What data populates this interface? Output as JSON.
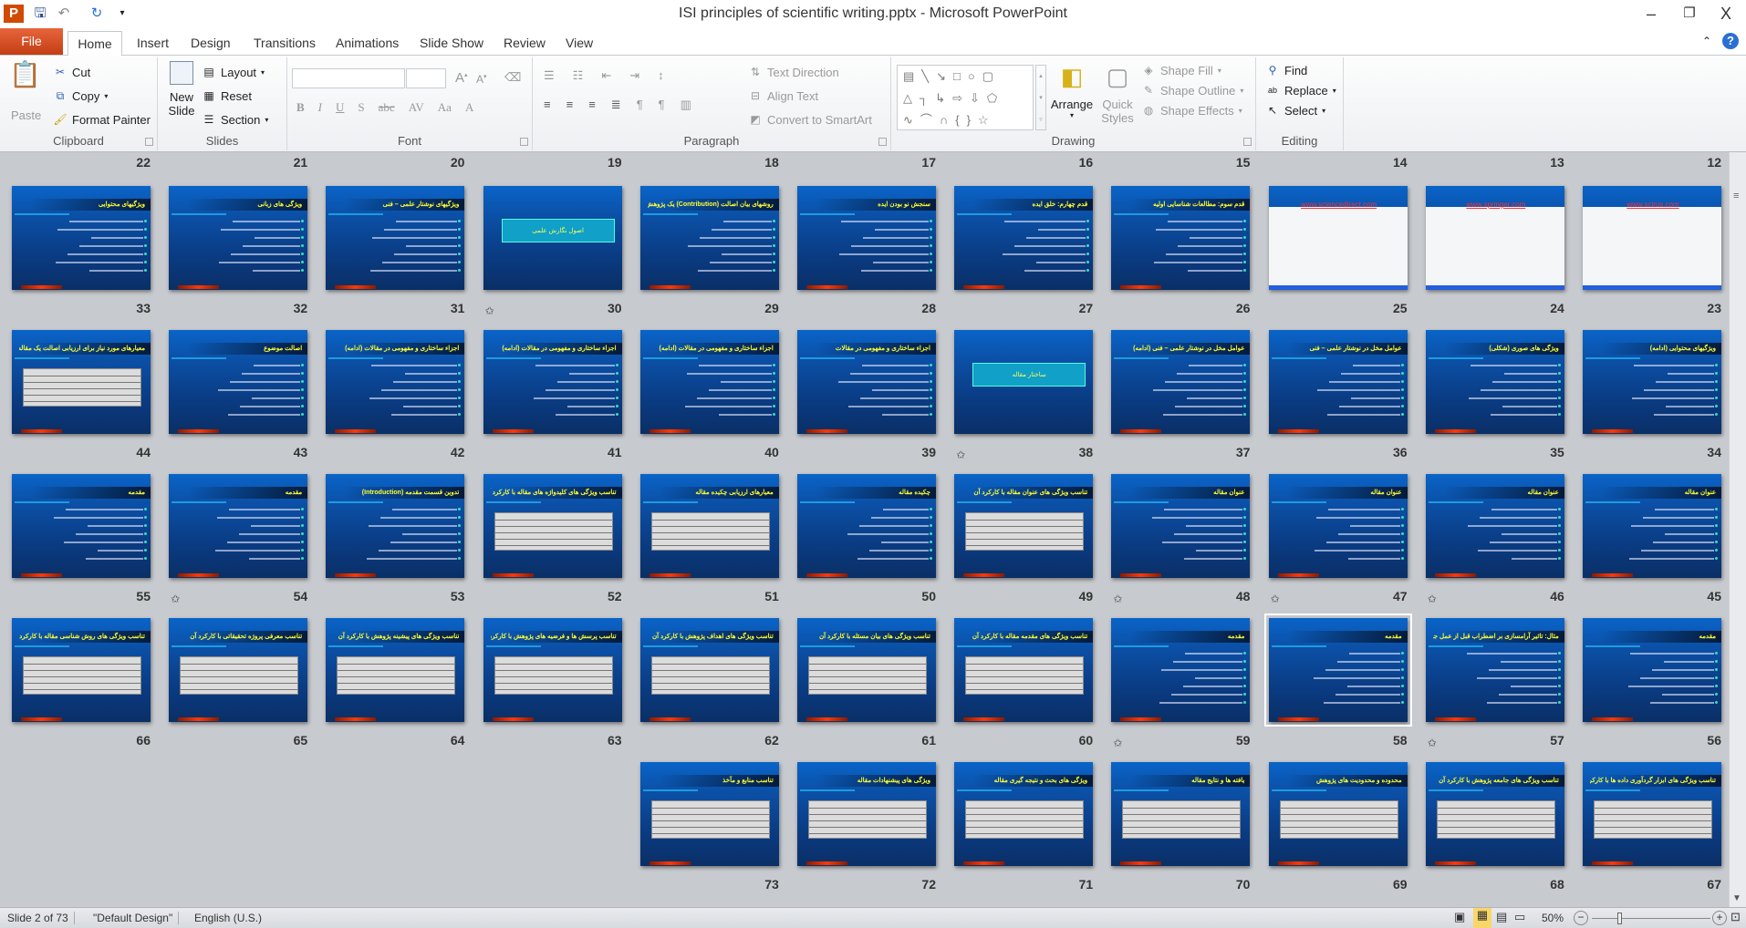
{
  "window": {
    "title": "ISI principles of scientific writing.pptx - Microsoft PowerPoint",
    "minimize": "–",
    "restore": "❐",
    "close": "X"
  },
  "quick_access": [
    "save-icon",
    "undo-icon",
    "redo-icon",
    "customize-icon"
  ],
  "tabs": {
    "file": "File",
    "items": [
      "Home",
      "Insert",
      "Design",
      "Transitions",
      "Animations",
      "Slide Show",
      "Review",
      "View"
    ],
    "active": "Home"
  },
  "ribbon": {
    "clipboard": {
      "label": "Clipboard",
      "paste": "Paste",
      "cut": "Cut",
      "copy": "Copy",
      "format_painter": "Format Painter"
    },
    "slides": {
      "label": "Slides",
      "new_slide_1": "New",
      "new_slide_2": "Slide",
      "layout": "Layout",
      "reset": "Reset",
      "section": "Section"
    },
    "font": {
      "label": "Font",
      "font_name": "",
      "font_size": ""
    },
    "paragraph": {
      "label": "Paragraph",
      "text_direction": "Text Direction",
      "align_text": "Align Text",
      "convert_smartart": "Convert to SmartArt"
    },
    "drawing": {
      "label": "Drawing",
      "arrange": "Arrange",
      "quick_styles_1": "Quick",
      "quick_styles_2": "Styles",
      "shape_fill": "Shape Fill",
      "shape_outline": "Shape Outline",
      "shape_effects": "Shape Effects"
    },
    "editing": {
      "label": "Editing",
      "find": "Find",
      "replace": "Replace",
      "select": "Select"
    }
  },
  "sorter": {
    "partial_row_numbers": [
      22,
      21,
      20,
      19,
      18,
      17,
      16,
      15,
      14,
      13,
      12
    ],
    "slides": [
      {
        "n": 23,
        "title": "www.scirus.com",
        "kind": "web"
      },
      {
        "n": 24,
        "title": "www.springer.com",
        "kind": "web"
      },
      {
        "n": 25,
        "title": "www.sciencedirect.com",
        "kind": "web"
      },
      {
        "n": 26,
        "title": "قدم سوم: مطالعات شناسایی اولیه",
        "kind": "bullets"
      },
      {
        "n": 27,
        "title": "قدم چهارم: خلق ایده",
        "kind": "bullets"
      },
      {
        "n": 28,
        "title": "سنجش نو بودن ایده",
        "kind": "bullets"
      },
      {
        "n": 29,
        "title": "روشهای بیان اصالت (Contribution) یک پژوهش",
        "kind": "bullets"
      },
      {
        "n": 30,
        "title": "اصول نگارش علمی",
        "kind": "section",
        "star": true
      },
      {
        "n": 31,
        "title": "ویژگیهای نوشتار علمی – فنی",
        "kind": "bullets"
      },
      {
        "n": 32,
        "title": "ویژگی های زبانی",
        "kind": "bullets"
      },
      {
        "n": 33,
        "title": "ویژگیهای محتوایی",
        "kind": "bullets"
      },
      {
        "n": 34,
        "title": "ویژگیهای محتوایی (ادامه)",
        "kind": "bullets"
      },
      {
        "n": 35,
        "title": "ویژگی های صوری (شکلی)",
        "kind": "bullets"
      },
      {
        "n": 36,
        "title": "عوامل مخل در نوشتار علمی – فنی",
        "kind": "bullets"
      },
      {
        "n": 37,
        "title": "عوامل مخل در نوشتار علمی – فنی (ادامه)",
        "kind": "bullets"
      },
      {
        "n": 38,
        "title": "ساختار مقاله",
        "kind": "section",
        "star": true
      },
      {
        "n": 39,
        "title": "اجزاء ساختاری و مفهومی در مقالات",
        "kind": "bullets"
      },
      {
        "n": 40,
        "title": "اجزاء ساختاری و مفهومی در مقالات (ادامه)",
        "kind": "bullets"
      },
      {
        "n": 41,
        "title": "اجزاء ساختاری و مفهومی در مقالات (ادامه)",
        "kind": "bullets"
      },
      {
        "n": 42,
        "title": "اجزاء ساختاری و مفهومی در مقالات (ادامه)",
        "kind": "bullets"
      },
      {
        "n": 43,
        "title": "اصالت موضوع",
        "kind": "bullets"
      },
      {
        "n": 44,
        "title": "معیارهای مورد نیاز برای ارزیابی اصالت یک مقاله",
        "kind": "table"
      },
      {
        "n": 45,
        "title": "عنوان مقاله",
        "kind": "bullets"
      },
      {
        "n": 46,
        "title": "عنوان مقاله",
        "kind": "bullets",
        "star": true
      },
      {
        "n": 47,
        "title": "عنوان مقاله",
        "kind": "bullets",
        "star": true
      },
      {
        "n": 48,
        "title": "عنوان مقاله",
        "kind": "bullets",
        "star": true
      },
      {
        "n": 49,
        "title": "تناسب ویژگی های عنوان مقاله با کارکرد آن",
        "kind": "table"
      },
      {
        "n": 50,
        "title": "چکیده مقاله",
        "kind": "bullets"
      },
      {
        "n": 51,
        "title": "معیارهای ارزیابی چکیده مقاله",
        "kind": "table"
      },
      {
        "n": 52,
        "title": "تناسب ویژگی های کلیدواژه های مقاله با کارکرد آن",
        "kind": "table"
      },
      {
        "n": 53,
        "title": "تدوین قسمت مقدمه (Introduction)",
        "kind": "bullets"
      },
      {
        "n": 54,
        "title": "مقدمه",
        "kind": "bullets",
        "star": true
      },
      {
        "n": 55,
        "title": "مقدمه",
        "kind": "bullets"
      },
      {
        "n": 56,
        "title": "مقدمه",
        "kind": "bullets"
      },
      {
        "n": 57,
        "title": "مثال: تاثیر آرامسازی بر اضطراب قبل از عمل جراحی",
        "kind": "bullets",
        "star": true
      },
      {
        "n": 58,
        "title": "مقدمه",
        "kind": "bullets",
        "selected": true
      },
      {
        "n": 59,
        "title": "مقدمه",
        "kind": "bullets",
        "star": true
      },
      {
        "n": 60,
        "title": "تناسب ویژگی های مقدمه مقاله با کارکرد آن",
        "kind": "table"
      },
      {
        "n": 61,
        "title": "تناسب ویژگی های بیان مسئله با کارکرد آن",
        "kind": "table"
      },
      {
        "n": 62,
        "title": "تناسب ویژگی های اهداف پژوهش با کارکرد آن",
        "kind": "table"
      },
      {
        "n": 63,
        "title": "تناسب پرسش ها و فرضیه های پژوهش با کارکرد آن",
        "kind": "table"
      },
      {
        "n": 64,
        "title": "تناسب ویژگی های پیشینه پژوهش با کارکرد آن",
        "kind": "table"
      },
      {
        "n": 65,
        "title": "تناسب معرفی پروژه تحقیقاتی با کارکرد آن",
        "kind": "table"
      },
      {
        "n": 66,
        "title": "تناسب ویژگی های روش شناسی مقاله با کارکرد آن",
        "kind": "table"
      },
      {
        "n": 67,
        "title": "تناسب ویژگی های ابزار گردآوری داده ها با کارکرد آن",
        "kind": "table"
      },
      {
        "n": 68,
        "title": "تناسب ویژگی های جامعه پژوهش با کارکرد آن",
        "kind": "table"
      },
      {
        "n": 69,
        "title": "محدوده و محدودیت های پژوهش",
        "kind": "table"
      },
      {
        "n": 70,
        "title": "یافته ها و نتایج مقاله",
        "kind": "table"
      },
      {
        "n": 71,
        "title": "ویژگی های بحث و نتیجه گیری مقاله",
        "kind": "table"
      },
      {
        "n": 72,
        "title": "ویژگی های پیشنهادات مقاله",
        "kind": "table"
      },
      {
        "n": 73,
        "title": "تناسب منابع و مآخذ",
        "kind": "table"
      }
    ]
  },
  "status": {
    "slide": "Slide 2 of 73",
    "theme": "\"Default Design\"",
    "language": "English (U.S.)",
    "zoom": "50%",
    "zoom_value": 50,
    "active_view": "slide-sorter"
  }
}
